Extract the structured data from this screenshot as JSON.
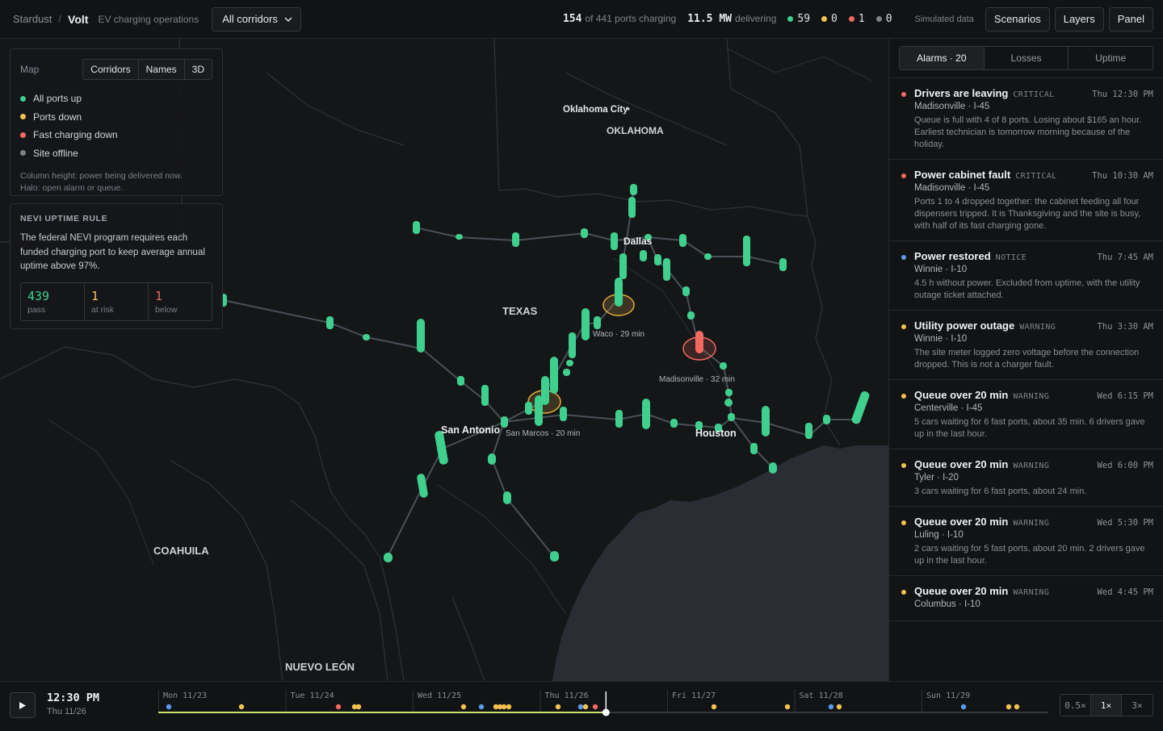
{
  "topbar": {
    "brand": "Stardust",
    "product": "Volt",
    "subtitle": "EV charging operations",
    "corridor_select": "All corridors",
    "ports_charging": "154",
    "ports_charging_label": "of 441 ports charging",
    "power": "11.5 MW",
    "power_label": "delivering",
    "counts": [
      {
        "value": "59",
        "color": "#3fcf8e"
      },
      {
        "value": "0",
        "color": "#f2c14e"
      },
      {
        "value": "1",
        "color": "#f06a5f"
      },
      {
        "value": "0",
        "color": "#7d8187"
      }
    ],
    "simulated": "Simulated data",
    "buttons": [
      "Scenarios",
      "Layers",
      "Panel"
    ]
  },
  "legend": {
    "title": "Map",
    "toggles": [
      "Corridors",
      "Names",
      "3D"
    ],
    "items": [
      {
        "label": "All ports up",
        "color": "#3fcf8e"
      },
      {
        "label": "Ports down",
        "color": "#f2c14e"
      },
      {
        "label": "Fast charging down",
        "color": "#f06a5f"
      },
      {
        "label": "Site offline",
        "color": "#7d8187"
      }
    ],
    "note1": "Column height: power being delivered now.",
    "note2": "Halo: open alarm or queue."
  },
  "nevi": {
    "title": "NEVI UPTIME RULE",
    "text": "The federal NEVI program requires each funded charging port to keep average annual uptime above 97%.",
    "stats": [
      {
        "value": "439",
        "label": "pass",
        "color": "#3fcf8e"
      },
      {
        "value": "1",
        "label": "at risk",
        "color": "#f2c14e"
      },
      {
        "value": "1",
        "label": "below",
        "color": "#f06a5f"
      }
    ]
  },
  "map": {
    "labels": {
      "okc": "Oklahoma City",
      "oklahoma": "OKLAHOMA",
      "texas": "TEXAS",
      "dallas": "Dallas",
      "san_antonio": "San Antonio",
      "houston": "Houston",
      "coahuila": "COAHUILA",
      "nuevo_leon": "NUEVO LEÓN",
      "waco": "Waco · 29 min",
      "madisonville": "Madisonville · 32 min",
      "san_marcos": "San Marcos · 20 min"
    }
  },
  "panel": {
    "tabs": [
      "Alarms · 20",
      "Losses",
      "Uptime"
    ],
    "alarms": [
      {
        "color": "#f06a5f",
        "title": "Drivers are leaving",
        "level": "CRITICAL",
        "time": "Thu 12:30 PM",
        "location": "Madisonville · I-45",
        "desc": "Queue is full with 4 of 8 ports. Losing about $165 an hour. Earliest technician is tomorrow morning because of the holiday."
      },
      {
        "color": "#f06a5f",
        "title": "Power cabinet fault",
        "level": "CRITICAL",
        "time": "Thu 10:30 AM",
        "location": "Madisonville · I-45",
        "desc": "Ports 1 to 4 dropped together: the cabinet feeding all four dispensers tripped. It is Thanksgiving and the site is busy, with half of its fast charging gone."
      },
      {
        "color": "#5a9bea",
        "title": "Power restored",
        "level": "NOTICE",
        "time": "Thu 7:45 AM",
        "location": "Winnie · I-10",
        "desc": "4.5 h without power. Excluded from uptime, with the utility outage ticket attached."
      },
      {
        "color": "#f2c14e",
        "title": "Utility power outage",
        "level": "WARNING",
        "time": "Thu 3:30 AM",
        "location": "Winnie · I-10",
        "desc": "The site meter logged zero voltage before the connection dropped. This is not a charger fault."
      },
      {
        "color": "#f2c14e",
        "title": "Queue over 20 min",
        "level": "WARNING",
        "time": "Wed 6:15 PM",
        "location": "Centerville · I-45",
        "desc": "5 cars waiting for 6 fast ports, about 35 min. 6 drivers gave up in the last hour."
      },
      {
        "color": "#f2c14e",
        "title": "Queue over 20 min",
        "level": "WARNING",
        "time": "Wed 6:00 PM",
        "location": "Tyler · I-20",
        "desc": "3 cars waiting for 6 fast ports, about 24 min."
      },
      {
        "color": "#f2c14e",
        "title": "Queue over 20 min",
        "level": "WARNING",
        "time": "Wed 5:30 PM",
        "location": "Luling · I-10",
        "desc": "2 cars waiting for 5 fast ports, about 20 min. 2 drivers gave up in the last hour."
      },
      {
        "color": "#f2c14e",
        "title": "Queue over 20 min",
        "level": "WARNING",
        "time": "Wed 4:45 PM",
        "location": "Columbus · I-10",
        "desc": ""
      }
    ]
  },
  "timeline": {
    "time": "12:30 PM",
    "day": "Thu 11/26",
    "days": [
      "Mon 11/23",
      "Tue 11/24",
      "Wed 11/25",
      "Thu 11/26",
      "Fri 11/27",
      "Sat 11/28",
      "Sun 11/29"
    ],
    "speeds": [
      "0.5×",
      "1×",
      "3×"
    ],
    "progress": 0.503
  }
}
